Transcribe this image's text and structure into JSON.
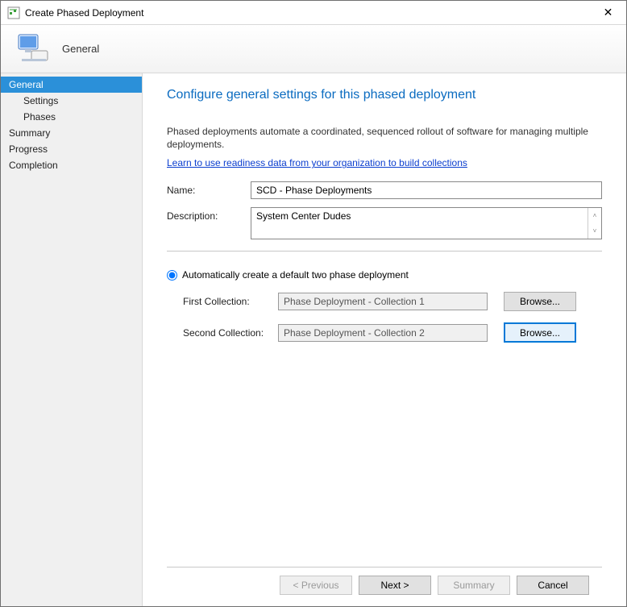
{
  "window": {
    "title": "Create Phased Deployment",
    "close_glyph": "✕"
  },
  "banner": {
    "label": "General"
  },
  "sidebar": {
    "items": [
      {
        "label": "General",
        "indent": false,
        "selected": true
      },
      {
        "label": "Settings",
        "indent": true,
        "selected": false
      },
      {
        "label": "Phases",
        "indent": true,
        "selected": false
      },
      {
        "label": "Summary",
        "indent": false,
        "selected": false
      },
      {
        "label": "Progress",
        "indent": false,
        "selected": false
      },
      {
        "label": "Completion",
        "indent": false,
        "selected": false
      }
    ]
  },
  "page": {
    "heading": "Configure general settings for this phased deployment",
    "intro": "Phased deployments automate a coordinated, sequenced rollout of software for managing multiple deployments.",
    "learn_link": "Learn to use readiness data from your organization to build collections",
    "name_label": "Name:",
    "name_value": "SCD - Phase Deployments",
    "desc_label": "Description:",
    "desc_value": "System Center Dudes",
    "radio_label": "Automatically create a default two phase deployment",
    "first_label": "First Collection:",
    "first_value": "Phase Deployment - Collection 1",
    "second_label": "Second Collection:",
    "second_value": "Phase Deployment - Collection 2",
    "browse_label": "Browse..."
  },
  "buttons": {
    "previous": "< Previous",
    "next": "Next >",
    "summary": "Summary",
    "cancel": "Cancel"
  }
}
